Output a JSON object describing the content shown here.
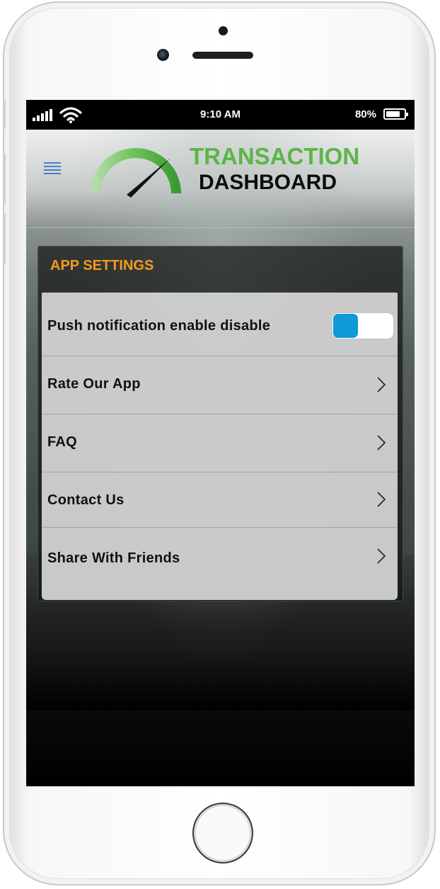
{
  "status_bar": {
    "time": "9:10 AM",
    "battery_percent": "80%",
    "battery_level": 0.8,
    "signal_icon": "signal-bars-icon",
    "wifi_icon": "wifi-icon"
  },
  "header": {
    "logo_line1": "TRANSACTION",
    "logo_line2": "DASHBOARD",
    "menu_icon": "hamburger-menu-icon",
    "logo_icon": "speedometer-gauge-icon",
    "colors": {
      "logo_green": "#5cb548",
      "menu_blue": "#4a7fc8"
    }
  },
  "settings": {
    "title": "APP SETTINGS",
    "title_color": "#f39a1f",
    "items": [
      {
        "label": "Push notification enable disable",
        "control": "toggle",
        "toggle_state": "off",
        "toggle_color": "#0f99d6"
      },
      {
        "label": "Rate Our App",
        "control": "chevron-right-icon"
      },
      {
        "label": "FAQ",
        "control": "chevron-right-icon"
      },
      {
        "label": "Contact Us",
        "control": "chevron-right-icon"
      },
      {
        "label": "Share With Friends",
        "control": "chevron-right-icon"
      }
    ]
  }
}
